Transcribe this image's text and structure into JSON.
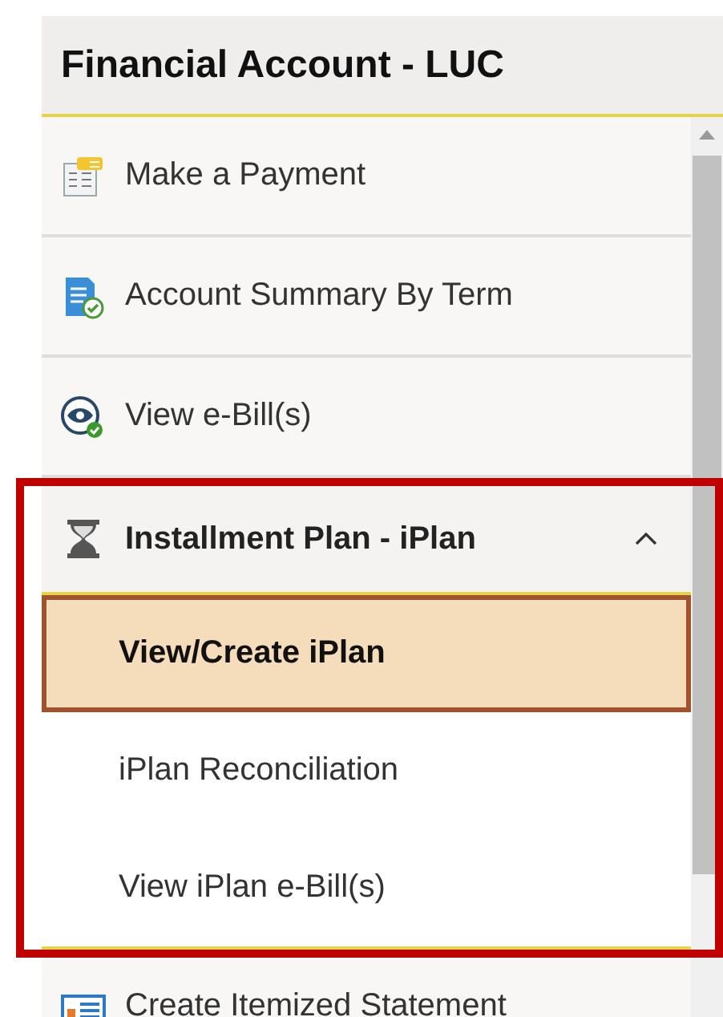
{
  "header": {
    "title": "Financial Account - LUC"
  },
  "items": [
    {
      "label": "Make a Payment"
    },
    {
      "label": "Account Summary By Term"
    },
    {
      "label": "View e-Bill(s)"
    }
  ],
  "group": {
    "label": "Installment Plan - iPlan",
    "expanded": true,
    "highlighted": true,
    "children": [
      {
        "label": "View/Create iPlan",
        "selected": true
      },
      {
        "label": "iPlan Reconciliation",
        "selected": false
      },
      {
        "label": "View iPlan e-Bill(s)",
        "selected": false
      }
    ]
  },
  "after": [
    {
      "label": "Create Itemized Statement"
    }
  ]
}
